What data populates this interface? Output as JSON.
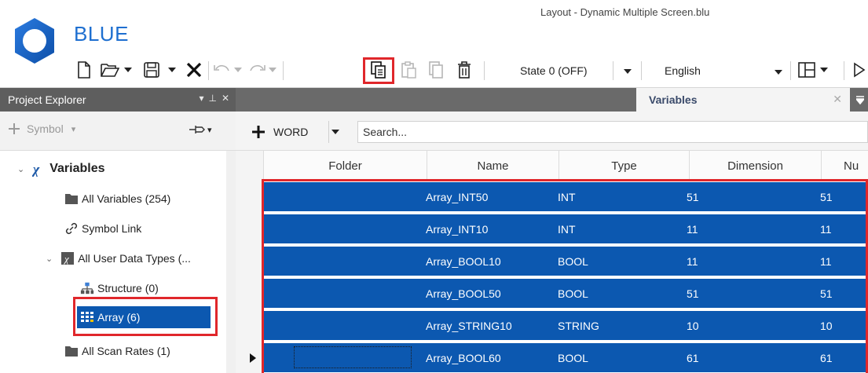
{
  "window": {
    "title": "Layout - Dynamic Multiple Screen.blu"
  },
  "app": {
    "name": "BLUE"
  },
  "toolbar": {
    "state_combo": "State 0 (OFF)",
    "language_combo": "English"
  },
  "project_explorer": {
    "title": "Project Explorer",
    "add_label": "Symbol",
    "tree": [
      {
        "label": "Variables",
        "icon": "variables-icon"
      },
      {
        "label": "All Variables (254)",
        "icon": "folder-icon"
      },
      {
        "label": "Symbol Link",
        "icon": "link-icon"
      },
      {
        "label": "All User Data Types (...",
        "icon": "udt-icon"
      },
      {
        "label": "Structure (0)",
        "icon": "structure-icon"
      },
      {
        "label": "Array (6)",
        "icon": "array-icon"
      },
      {
        "label": "All Scan Rates (1)",
        "icon": "folder-icon"
      }
    ]
  },
  "document": {
    "tab_label": "Variables",
    "add_type": "WORD",
    "search_placeholder": "Search...",
    "columns": [
      "Folder",
      "Name",
      "Type",
      "Dimension",
      "Nu"
    ],
    "rows": [
      {
        "folder": "",
        "name": "Array_INT50",
        "type": "INT",
        "dimension": "51",
        "num": "51"
      },
      {
        "folder": "",
        "name": "Array_INT10",
        "type": "INT",
        "dimension": "11",
        "num": "11"
      },
      {
        "folder": "",
        "name": "Array_BOOL10",
        "type": "BOOL",
        "dimension": "11",
        "num": "11"
      },
      {
        "folder": "",
        "name": "Array_BOOL50",
        "type": "BOOL",
        "dimension": "51",
        "num": "51"
      },
      {
        "folder": "",
        "name": "Array_STRING10",
        "type": "STRING",
        "dimension": "10",
        "num": "10"
      },
      {
        "folder": "",
        "name": "Array_BOOL60",
        "type": "BOOL",
        "dimension": "61",
        "num": "61"
      }
    ]
  },
  "colors": {
    "selection": "#0c58b0",
    "highlight": "#e0272b",
    "brand": "#1e6fd0"
  }
}
